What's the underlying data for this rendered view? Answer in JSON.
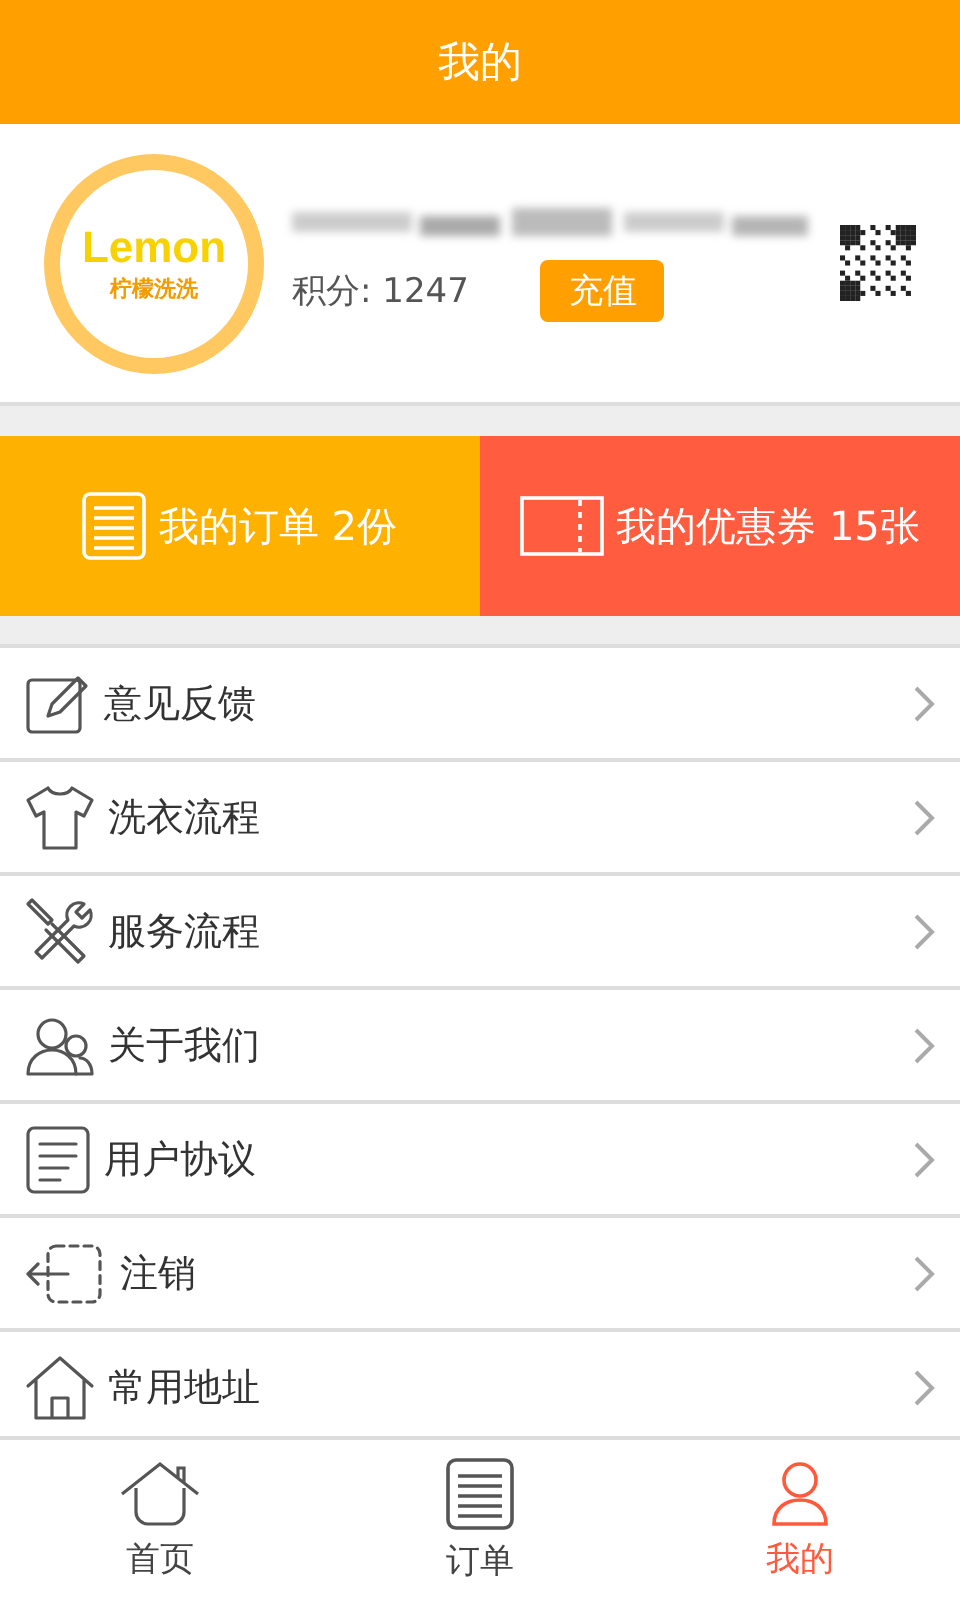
{
  "header": {
    "title": "我的"
  },
  "profile": {
    "logo_word": "Lemon",
    "logo_caption": "柠檬洗洗",
    "points_label": "积分: 1247",
    "recharge_button": "充值"
  },
  "cards": [
    {
      "label": "我的订单 2份",
      "color": "#ffb100"
    },
    {
      "label": "我的优惠券 15张",
      "color": "#ff5c40"
    }
  ],
  "menu": [
    {
      "label": "意见反馈"
    },
    {
      "label": "洗衣流程"
    },
    {
      "label": "服务流程"
    },
    {
      "label": "关于我们"
    },
    {
      "label": "用户协议"
    },
    {
      "label": "注销"
    },
    {
      "label": "常用地址"
    }
  ],
  "tabs": [
    {
      "label": "首页",
      "selected": false
    },
    {
      "label": "订单",
      "selected": false
    },
    {
      "label": "我的",
      "selected": true
    }
  ]
}
